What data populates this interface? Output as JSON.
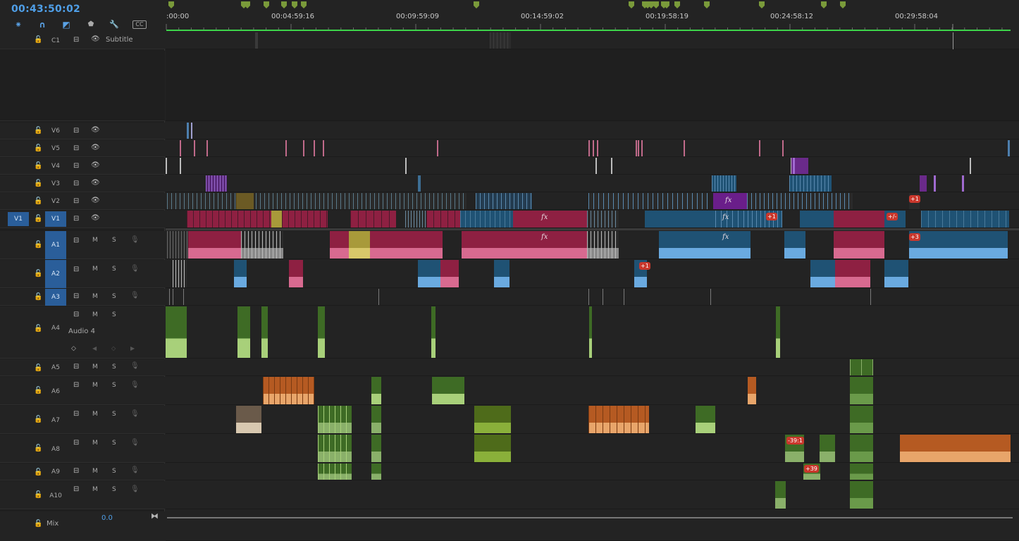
{
  "header": {
    "timecode": "00:43:50:02",
    "tools": [
      {
        "name": "nest-icon",
        "glyph": "⁕"
      },
      {
        "name": "snap-icon",
        "glyph": "∩"
      },
      {
        "name": "linked-selection-icon",
        "glyph": "◩"
      },
      {
        "name": "add-marker-icon",
        "glyph": "⬟"
      },
      {
        "name": "wrench-icon",
        "glyph": "🔧"
      },
      {
        "name": "captions-icon",
        "glyph": "CC"
      }
    ]
  },
  "ruler": {
    "labels": [
      ":00:00",
      "00:04:59:16",
      "00:09:59:09",
      "00:14:59:02",
      "00:19:58:19",
      "00:24:58:12",
      "00:29:58:04"
    ]
  },
  "tracks": {
    "subtitle": {
      "id": "C1",
      "label": "Subtitle"
    },
    "video": [
      "V6",
      "V5",
      "V4",
      "V3",
      "V2",
      "V1"
    ],
    "source_video": "V1",
    "audio": [
      "A1",
      "A2",
      "A3",
      "A4",
      "A5",
      "A6",
      "A7",
      "A8",
      "A9",
      "A10"
    ],
    "source_audio": [
      "A1",
      "A2",
      "A3"
    ],
    "a4_label": "Audio 4",
    "mix_label": "Mix",
    "mix_value": "0.0",
    "mute_label": "M",
    "solo_label": "S"
  },
  "badges": [
    "+1",
    "+1",
    "+/-",
    "+3",
    "+1",
    "-39:1",
    "+39"
  ],
  "colors": {
    "accent": "#4f9fe8",
    "work_area": "#3dd34a",
    "clip_rose": "#8e2042",
    "clip_blue": "#1f5274",
    "clip_green": "#3e6b25",
    "clip_orange": "#b55a22",
    "clip_violet": "#6a1e8a"
  }
}
